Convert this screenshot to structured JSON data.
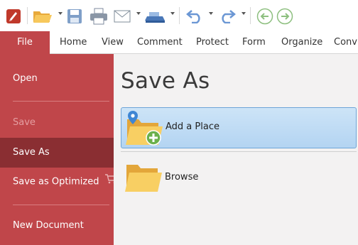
{
  "ribbon": {
    "tabs": [
      "File",
      "Home",
      "View",
      "Comment",
      "Protect",
      "Form",
      "Organize",
      "Conv"
    ]
  },
  "sidebar": {
    "items": [
      "Open",
      "Save",
      "Save As",
      "Save as Optimized",
      "New Document"
    ]
  },
  "main": {
    "title": "Save As",
    "places": [
      {
        "label": "Add a Place",
        "icon": "folder-add-place-icon"
      },
      {
        "label": "Browse",
        "icon": "folder-icon"
      }
    ]
  },
  "toolbar": {
    "icons": [
      "app-logo-icon",
      "open-folder-icon",
      "save-icon",
      "print-icon",
      "email-icon",
      "scan-icon",
      "undo-icon",
      "redo-icon",
      "previous-view-icon",
      "next-view-icon"
    ]
  },
  "colors": {
    "sidebar": "#c0464a",
    "sidebar_active": "#8a2e32",
    "selection": "#b3d4f2"
  }
}
